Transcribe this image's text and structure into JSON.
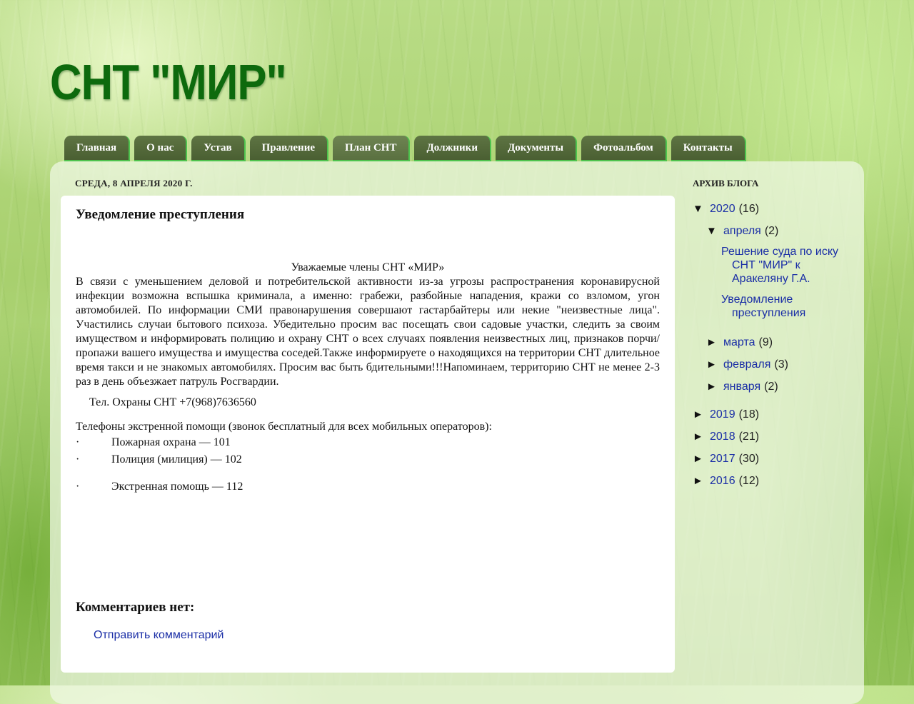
{
  "header": {
    "title": "СНТ \"МИР\""
  },
  "nav": [
    {
      "label": "Главная"
    },
    {
      "label": "О нас"
    },
    {
      "label": "Устав"
    },
    {
      "label": "Правление"
    },
    {
      "label": "План СНТ"
    },
    {
      "label": "Должники"
    },
    {
      "label": "Документы"
    },
    {
      "label": "Фотоальбом"
    },
    {
      "label": "Контакты"
    }
  ],
  "post": {
    "date": "СРЕДА, 8 АПРЕЛЯ 2020 Г.",
    "title": "Уведомление преступления",
    "greeting": "Уважаемые члены СНТ «МИР»",
    "body": "В связи с уменьшением деловой и потребительской активности из-за угрозы распространения коронавирусной инфекции возможна вспышка криминала, а именно: грабежи, разбойные нападения, кражи со взломом, угон автомобилей. По информации СМИ правонарушения совершают гастарбайтеры или некие \"неизвестные лица\". Участились случаи бытового психоза. Убедительно просим вас посещать свои садовые участки, следить за своим имуществом и информировать полицию и охрану СНТ о всех случаях появления неизвестных лиц, признаков порчи/пропажи вашего имущества и имущества соседей.Также информируете о находящихся на территории СНТ длительное время  такси и не знакомых автомобилях. Просим вас быть бдительными!!!Напоминаем, территорию СНТ не менее 2-3 раз в день объезжает патруль Росгвардии.",
    "phone": "Тел. Охраны СНТ  +7(968)7636560",
    "emergency_title": "Телефоны экстренной помощи (звонок бесплатный для всех мобильных операторов):",
    "bullet": "·",
    "emergency": [
      "Пожарная охрана — 101",
      "Полиция (милиция) — 102",
      "Экстренная помощь  — 112"
    ],
    "comments_title": "Комментариев нет:",
    "comment_link": "Отправить комментарий"
  },
  "sidebar": {
    "title": "АРХИВ БЛОГА",
    "expanded_icon": "▼",
    "collapsed_icon": "►",
    "year2020": {
      "label": "2020",
      "count": "(16)"
    },
    "april": {
      "label": "апреля",
      "count": "(2)",
      "posts": [
        "Решение суда по иску СНТ \"МИР\" к Аракеляну Г.А.",
        "Уведомление преступления"
      ]
    },
    "months": [
      {
        "label": "марта",
        "count": "(9)"
      },
      {
        "label": "февраля",
        "count": "(3)"
      },
      {
        "label": "января",
        "count": "(2)"
      }
    ],
    "years": [
      {
        "label": "2019",
        "count": "(18)"
      },
      {
        "label": "2018",
        "count": "(21)"
      },
      {
        "label": "2017",
        "count": "(30)"
      },
      {
        "label": "2016",
        "count": "(12)"
      }
    ]
  }
}
